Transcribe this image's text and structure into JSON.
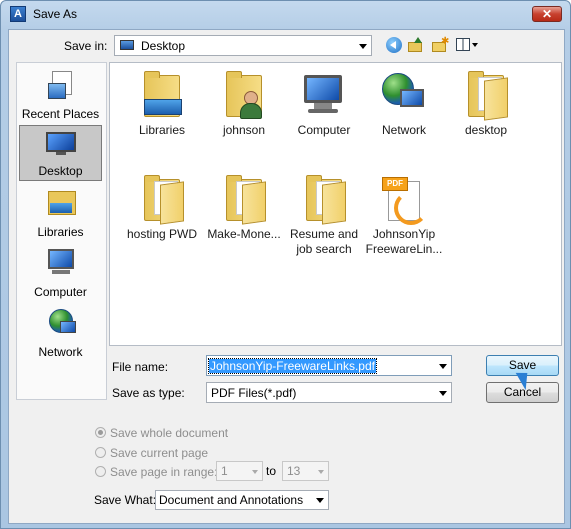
{
  "window": {
    "title": "Save As",
    "close_label": "✕"
  },
  "toolbar": {
    "save_in_label": "Save in:",
    "save_in_value": "Desktop"
  },
  "places": [
    {
      "label": "Recent Places",
      "icon": "recent-places-icon"
    },
    {
      "label": "Desktop",
      "icon": "desktop-icon",
      "selected": true
    },
    {
      "label": "Libraries",
      "icon": "libraries-icon"
    },
    {
      "label": "Computer",
      "icon": "computer-icon"
    },
    {
      "label": "Network",
      "icon": "network-icon"
    }
  ],
  "files": [
    {
      "line1": "Libraries",
      "line2": "",
      "icon": "libraries-icon"
    },
    {
      "line1": "johnson",
      "line2": "",
      "icon": "user-folder-icon"
    },
    {
      "line1": "Computer",
      "line2": "",
      "icon": "computer-icon"
    },
    {
      "line1": "Network",
      "line2": "",
      "icon": "network-icon"
    },
    {
      "line1": "desktop",
      "line2": "",
      "icon": "folder-icon"
    },
    {
      "line1": "hosting PWD",
      "line2": "",
      "icon": "folder-icon"
    },
    {
      "line1": "Make-Mone...",
      "line2": "",
      "icon": "folder-icon"
    },
    {
      "line1": "Resume and",
      "line2": "job search",
      "icon": "folder-icon"
    },
    {
      "line1": "JohnsonYip",
      "line2": "FreewareLin...",
      "icon": "pdf-file-icon"
    }
  ],
  "form": {
    "file_name_label": "File name:",
    "file_name_value": "JohnsonYip-FreewareLinks.pdf",
    "save_type_label": "Save as type:",
    "save_type_value": "PDF Files(*.pdf)",
    "save_button": "Save",
    "cancel_button": "Cancel"
  },
  "options": {
    "whole_document": "Save whole document",
    "current_page": "Save current page",
    "page_range": "Save page in range:",
    "range_from": "1",
    "range_to_label": "to",
    "range_to": "13",
    "save_what_label": "Save What:",
    "save_what_value": "Document and Annotations"
  },
  "pdf_tag": "PDF"
}
